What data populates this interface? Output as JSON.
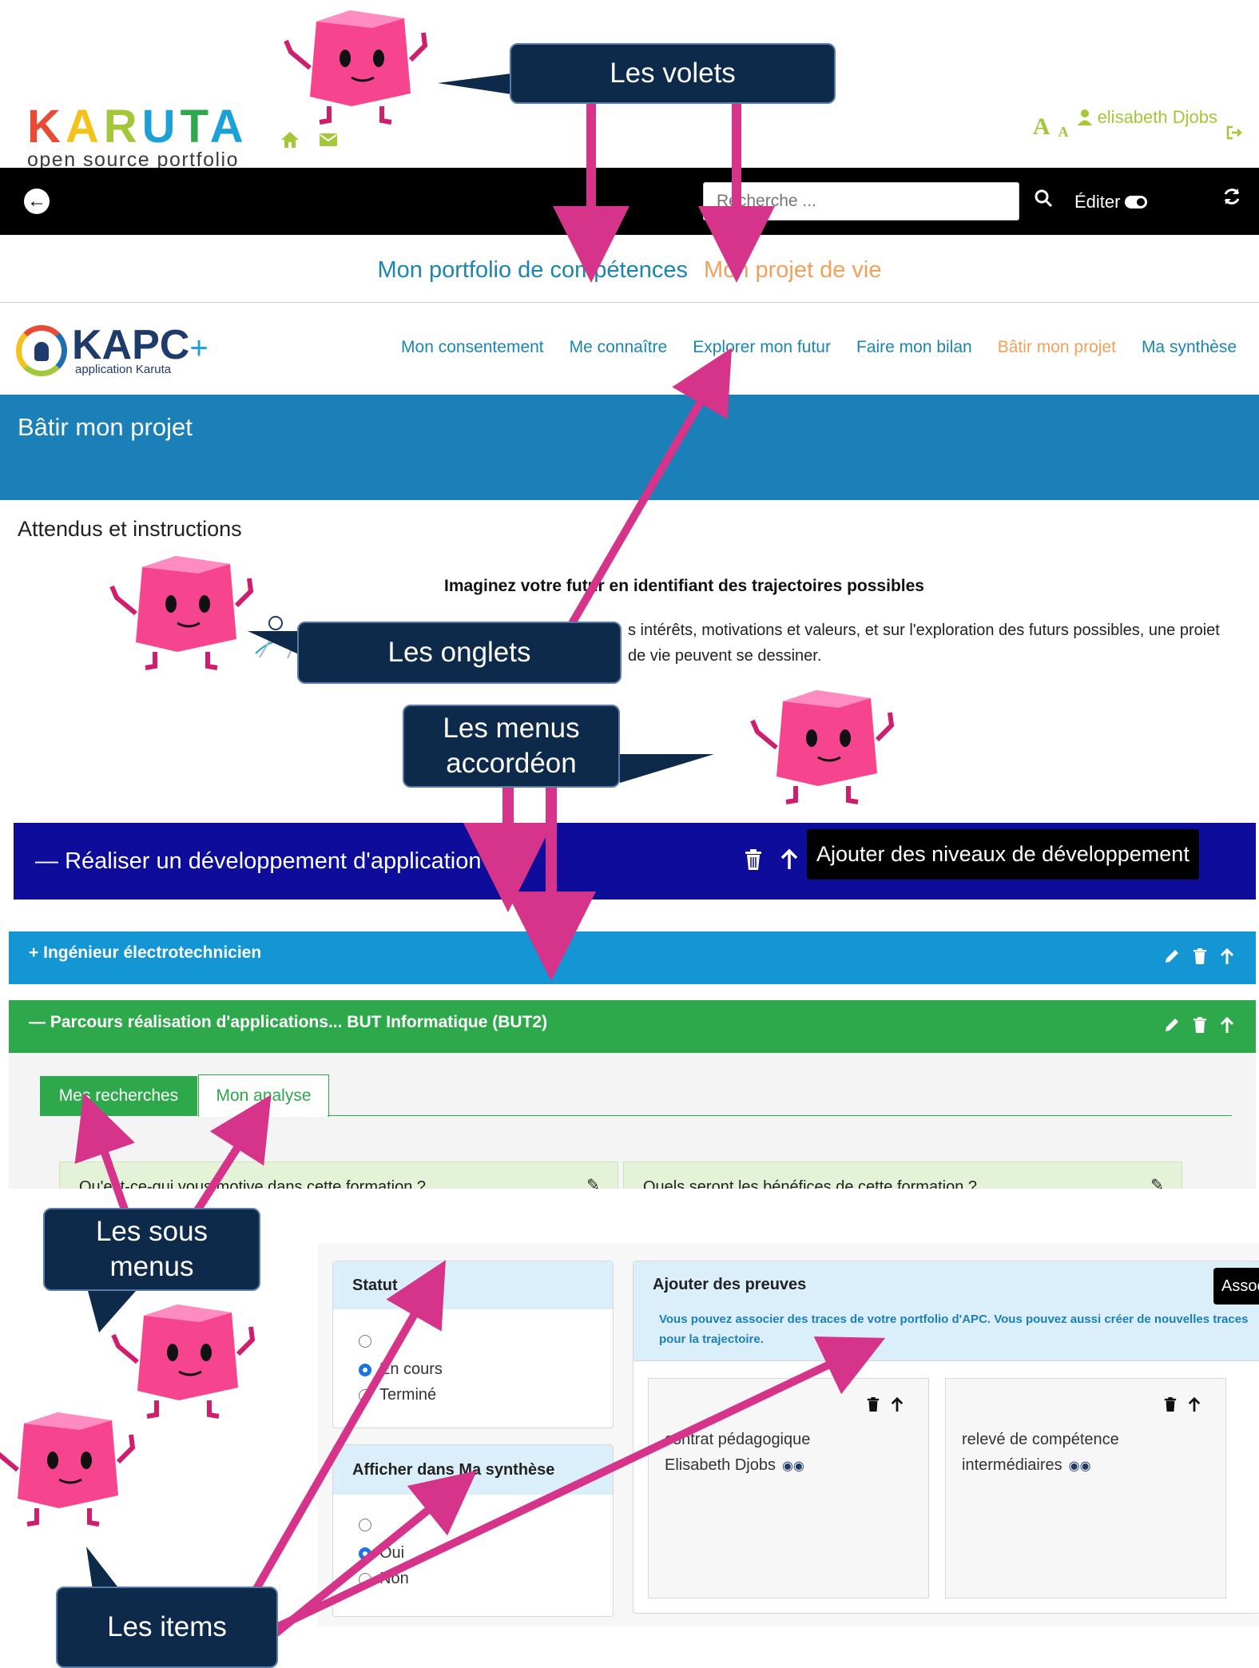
{
  "header": {
    "logo_word": "KARUTA",
    "logo_sub": "open source portfolio",
    "font_large": "A",
    "font_small": "A",
    "user_name": "elisabeth Djobs",
    "search_placeholder": "Recherche ...",
    "edit_label": "Éditer"
  },
  "volets": [
    "Mon portfolio de compétences",
    "Mon projet de vie"
  ],
  "kapc": {
    "logo_word": "KAPC",
    "logo_plus": "+",
    "logo_sub": "application Karuta",
    "tabs": [
      "Mon consentement",
      "Me connaître",
      "Explorer mon futur",
      "Faire mon bilan",
      "Bâtir mon projet",
      "Ma synthèse"
    ],
    "active_tab": "Bâtir mon projet"
  },
  "page": {
    "title": "Bâtir mon projet",
    "instructions_title": "Attendus et instructions",
    "instructions_strong": "Imaginez votre futur en identifiant des trajectoires possibles",
    "instructions_text": "s intérêts, motivations et valeurs, et sur l'exploration des futurs possibles, une proiet de vie peuvent se dessiner."
  },
  "accordions": {
    "main_title": "Réaliser un développement d'application",
    "add_levels": "Ajouter des niveaux de développement",
    "item1_title": "Ingénieur électrotechnicien",
    "item2_title": "Parcours réalisation d'applications... BUT Informatique (BUT2)"
  },
  "subtabs": [
    "Mes recherches",
    "Mon analyse"
  ],
  "questions": [
    "Qu'est-ce-qui vous motive dans cette formation ?",
    "Quels seront les bénéfices de cette formation ?"
  ],
  "items": {
    "statut_title": "Statut",
    "statut_options": [
      "",
      "En cours",
      "Terminé"
    ],
    "afficher_title": "Afficher dans Ma synthèse",
    "afficher_options": [
      "",
      "Oui",
      "Non"
    ],
    "preuves_title": "Ajouter des preuves",
    "preuves_sub": "Vous pouvez associer des traces de votre portfolio d'APC. Vous pouvez aussi créer de nouvelles traces pour la trajectoire.",
    "associate_button": "Associer",
    "trace1_lines": [
      "contrat pédagogique",
      "Elisabeth Djobs"
    ],
    "trace2_lines": [
      "relevé de compétence",
      "intermédiaires"
    ]
  },
  "callouts": {
    "volets": "Les volets",
    "onglets": "Les onglets",
    "menus_accordeon": "Les menus accordéon",
    "sous_menus": "Les sous menus",
    "items": "Les items"
  },
  "colors": {
    "karuta_k": "#e84b35",
    "karuta_a1": "#f5c21a",
    "karuta_r": "#a4c639",
    "karuta_u": "#1ba1d8",
    "karuta_t": "#2da84a",
    "karuta_a2": "#1ba1d8",
    "accent_green": "#a4c639",
    "volet_blue": "#1a86b0",
    "volet_orange": "#f2a05a",
    "banner_blue": "#1c80b8",
    "accordion_dark": "#0e0c9a",
    "accordion_blue": "#1496d4",
    "accordion_green": "#2da84a",
    "callout_bg": "#0d2a4b",
    "arrow_pink": "#d6338a",
    "mascot_pink": "#f7448e"
  }
}
